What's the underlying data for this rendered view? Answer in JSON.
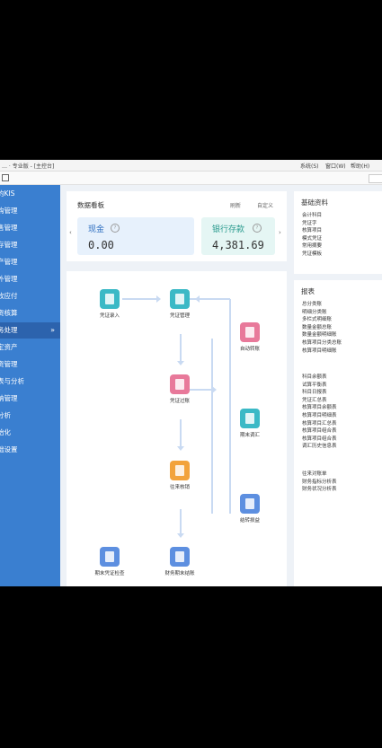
{
  "titlebar": {
    "title": "… · 专业版 - [主控台]",
    "menu": [
      "系统(S)",
      "窗口(W)",
      "帮助(H)"
    ]
  },
  "sidebar": {
    "items": [
      {
        "label": "的KIS"
      },
      {
        "label": "购管理"
      },
      {
        "label": "售管理"
      },
      {
        "label": "存管理"
      },
      {
        "label": "产管理"
      },
      {
        "label": "外管理"
      },
      {
        "label": "收应付"
      },
      {
        "label": "资核算"
      },
      {
        "label": "务处理",
        "active": true
      },
      {
        "label": "定资产"
      },
      {
        "label": "资管理"
      },
      {
        "label": "表与分析"
      },
      {
        "label": "纳管理"
      },
      {
        "label": "分析"
      },
      {
        "label": "始化"
      },
      {
        "label": "础设置"
      }
    ],
    "active_arrow": "»"
  },
  "dashboard": {
    "title": "数据看板",
    "refresh": "刷新",
    "customize": "自定义",
    "cash": {
      "label": "现金",
      "value": "0.00"
    },
    "bank": {
      "label": "银行存款",
      "value": "4,381.69"
    }
  },
  "flow": {
    "nodes": [
      {
        "name": "voucher-entry",
        "label": "凭证录入",
        "icon": "book-icon",
        "color": "#3bb9c6"
      },
      {
        "name": "voucher-manage",
        "label": "凭证管理",
        "icon": "document-icon",
        "color": "#3bb9c6"
      },
      {
        "name": "voucher-post",
        "label": "凭证过账",
        "icon": "ledger-icon",
        "color": "#e8799a"
      },
      {
        "name": "auto-transfer",
        "label": "自动转账",
        "icon": "transfer-icon",
        "color": "#e8799a"
      },
      {
        "name": "period-end-fx",
        "label": "期末调汇",
        "icon": "exchange-icon",
        "color": "#3bb9c6"
      },
      {
        "name": "pl-transfer",
        "label": "结转损益",
        "icon": "profit-icon",
        "color": "#5d8fe0"
      },
      {
        "name": "reconcile",
        "label": "往来核销",
        "icon": "gear-icon",
        "color": "#f2a33c"
      },
      {
        "name": "period-end-check",
        "label": "期末凭证检查",
        "icon": "bulb-icon",
        "color": "#5d8fe0"
      },
      {
        "name": "period-end-close",
        "label": "财务期末结账",
        "icon": "lock-book-icon",
        "color": "#5d8fe0"
      }
    ]
  },
  "basic_info": {
    "title": "基础资料",
    "items": [
      "会计科目",
      "凭证字",
      "核算项目",
      "模式凭证",
      "常用摘要",
      "凭证模板"
    ]
  },
  "reports": {
    "title": "报表",
    "groups": [
      [
        "总分类账",
        "明细分类账",
        "多栏式明细账",
        "数量金额总账",
        "数量金额明细账",
        "核算项目分类总账",
        "核算项目明细账"
      ],
      [
        "科目余额表",
        "试算平衡表",
        "科目日报表",
        "凭证汇总表",
        "核算项目余额表",
        "核算项目明细表",
        "核算项目汇总表",
        "核算项目组合表",
        "核算项目组合表",
        "调汇历史信息表"
      ],
      [
        "往来对账单",
        "财务指标分析表",
        "财务状况分析表"
      ]
    ]
  }
}
